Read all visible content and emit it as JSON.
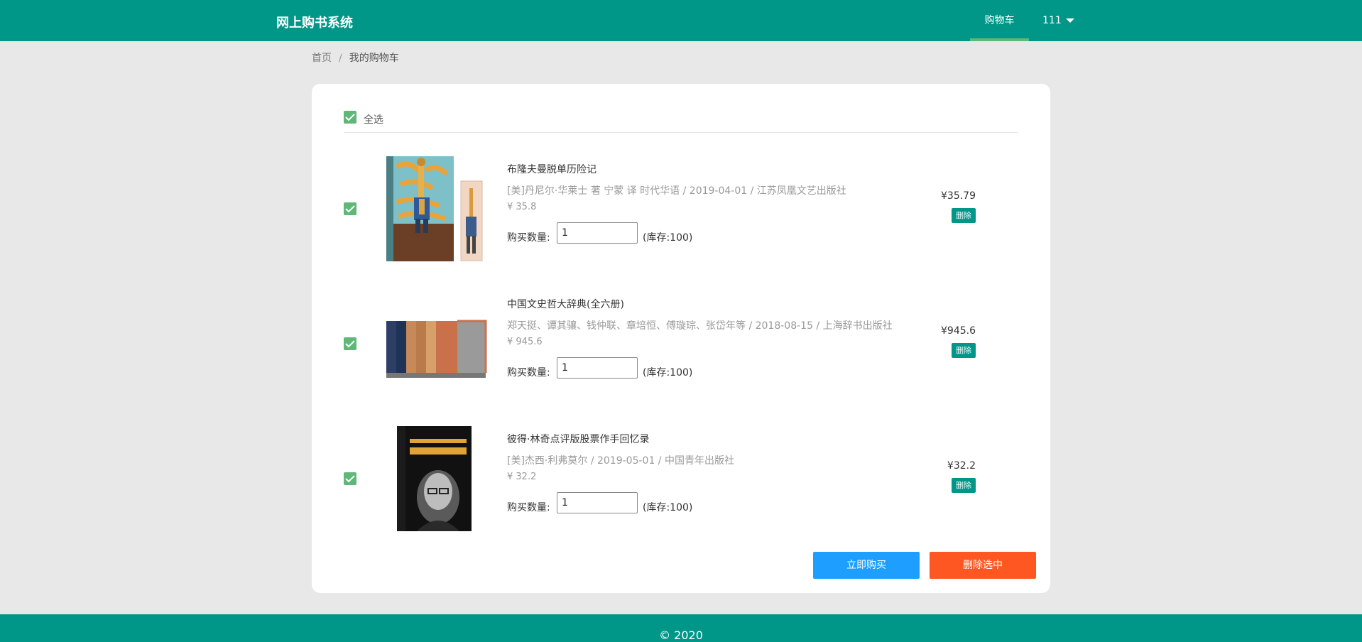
{
  "header": {
    "brand": "网上购书系统",
    "nav_cart": "购物车",
    "nav_user": "111"
  },
  "breadcrumb": {
    "home": "首页",
    "separator": "/",
    "current": "我的购物车"
  },
  "cart": {
    "select_all_label": "全选",
    "items": [
      {
        "title": "布隆夫曼脱单历险记",
        "meta": "[美]丹尼尔·华莱士 著 宁蒙 译 时代华语 / 2019-04-01 / 江苏凤凰文艺出版社",
        "unit_price": "¥ 35.8",
        "qty_label": "购买数量:",
        "qty_value": "1",
        "stock": "(库存:100)",
        "subtotal": "¥35.79",
        "delete_label": "删除",
        "checked": true
      },
      {
        "title": "中国文史哲大辞典(全六册)",
        "meta": "郑天挺、谭其骧、钱仲联、章培恒、傅璇琮、张岱年等 / 2018-08-15 / 上海辞书出版社",
        "unit_price": "¥ 945.6",
        "qty_label": "购买数量:",
        "qty_value": "1",
        "stock": "(库存:100)",
        "subtotal": "¥945.6",
        "delete_label": "删除",
        "checked": true
      },
      {
        "title": "彼得·林奇点评版股票作手回忆录",
        "meta": "[美]杰西·利弗莫尔 / 2019-05-01 / 中国青年出版社",
        "unit_price": "¥ 32.2",
        "qty_label": "购买数量:",
        "qty_value": "1",
        "stock": "(库存:100)",
        "subtotal": "¥32.2",
        "delete_label": "删除",
        "checked": true
      }
    ],
    "buy_now_label": "立即购买",
    "delete_selected_label": "删除选中"
  },
  "footer": {
    "copyright": "© 2020"
  },
  "colors": {
    "header_bg": "#009688",
    "nav_active_underline": "#5fb878",
    "checkbox": "#5fb878",
    "buy_button": "#1e9fff",
    "delete_selected_button": "#ff5722"
  }
}
